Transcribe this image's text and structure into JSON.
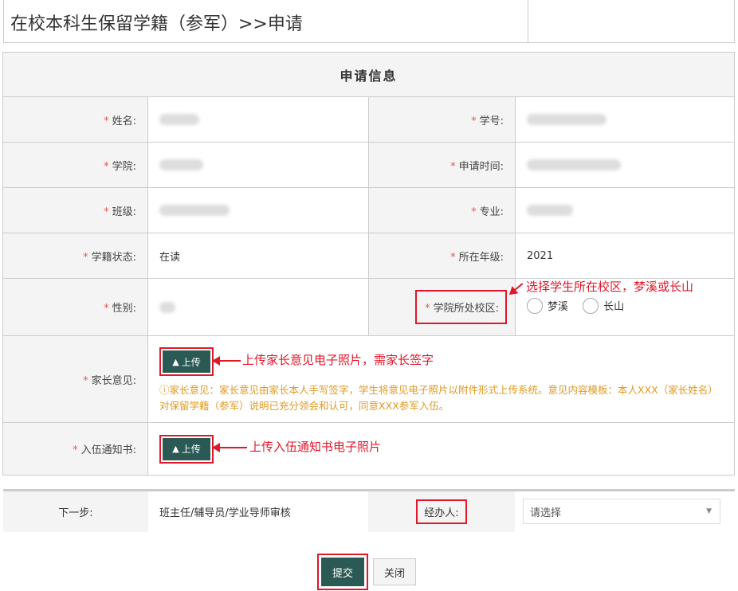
{
  "page": {
    "title": "在校本科生保留学籍（参军）>>申请"
  },
  "form": {
    "section_title": "申请信息",
    "required_mark": "*",
    "fields": {
      "name_label": "姓名:",
      "student_id_label": "学号:",
      "college_label": "学院:",
      "apply_time_label": "申请时间:",
      "class_label": "班级:",
      "major_label": "专业:",
      "status_label": "学籍状态:",
      "status_value": "在读",
      "grade_label": "所在年级:",
      "grade_value": "2021",
      "gender_label": "性别:",
      "campus_label": "学院所处校区:",
      "campus_options": [
        "梦溪",
        "长山"
      ],
      "parent_opinion_label": "家长意见:",
      "notice_label": "入伍通知书:"
    },
    "upload_label": "上传",
    "parent_hint": "家长意见：家长意见由家长本人手写签字，学生将意见电子照片以附件形式上传系统。意见内容模板：本人XXX（家长姓名）对保留学籍（参军）说明已充分领会和认可，同意XXX参军入伍。"
  },
  "annotations": {
    "campus_note": "选择学生所在校区，梦溪或长山",
    "parent_note": "上传家长意见电子照片，需家长签字",
    "notice_note": "上传入伍通知书电子照片"
  },
  "next_step": {
    "label": "下一步:",
    "value": "班主任/辅导员/学业导师审核",
    "handler_label": "经办人:",
    "handler_placeholder": "请选择"
  },
  "actions": {
    "submit": "提交",
    "close": "关闭"
  },
  "colors": {
    "primary": "#2b5a55",
    "annotation_red": "#e0182a",
    "hint_orange": "#e19a23",
    "required_red": "#e05a4e"
  }
}
